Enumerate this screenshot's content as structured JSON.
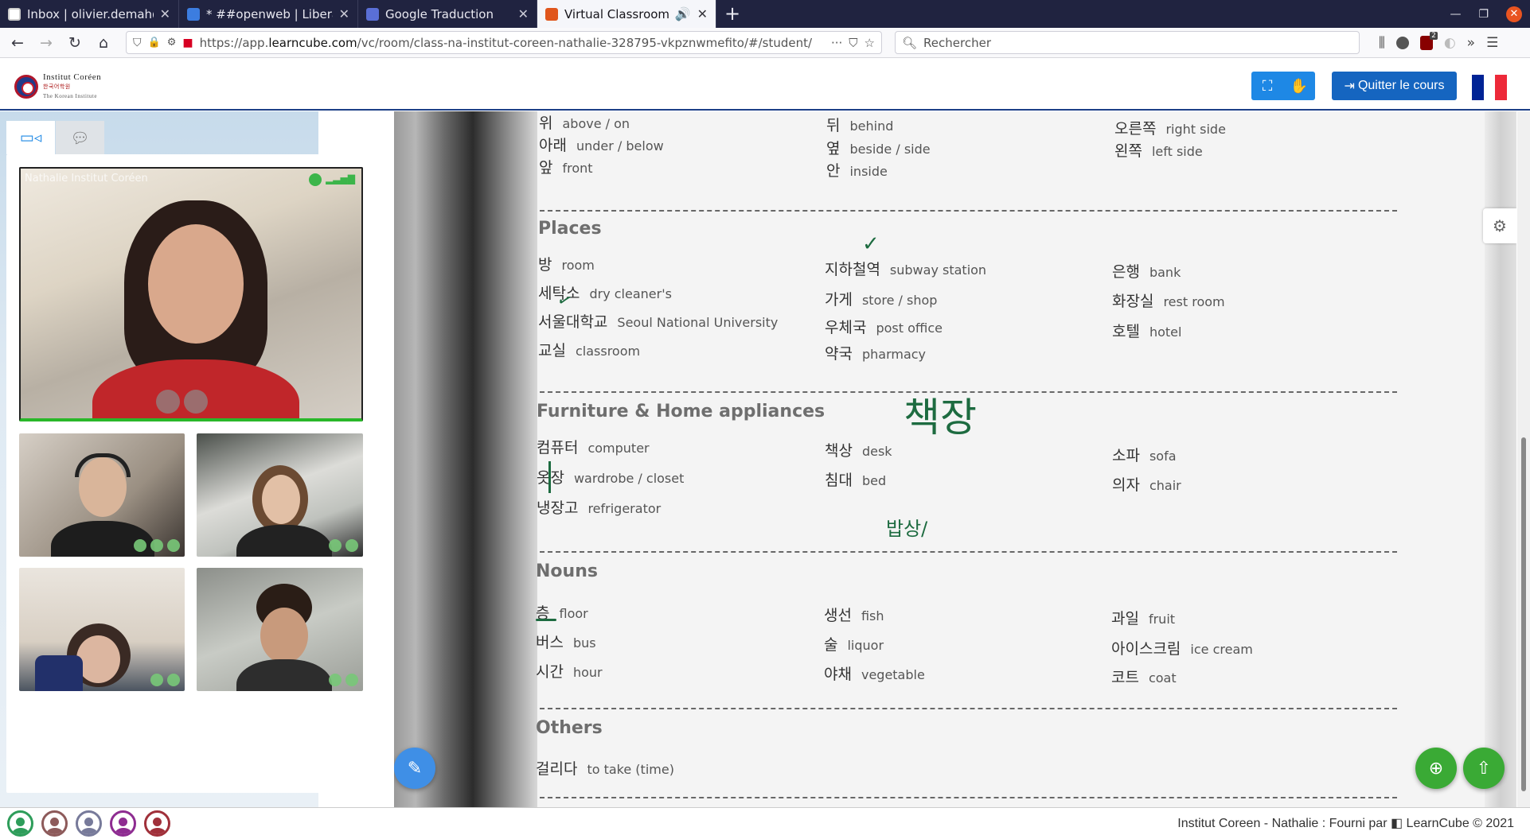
{
  "browser": {
    "tabs": [
      {
        "title": "Inbox | olivier.demah@pr",
        "icon": "envelope-icon"
      },
      {
        "title": "* ##openweb | Libera.Ch",
        "icon": "chat-icon"
      },
      {
        "title": "Google Traduction",
        "icon": "translate-icon"
      },
      {
        "title": "Virtual Classroom | Le",
        "icon": "learncube-icon",
        "active": true
      }
    ],
    "url_prefix": "https://app.",
    "url_domain": "learncube.com",
    "url_path": "/vc/room/class-na-institut-coreen-nathalie-328795-vkpznwmefito/#/student/",
    "search_placeholder": "Rechercher",
    "ublock_badge": "2"
  },
  "app": {
    "logo_line1": "Institut Coréen",
    "logo_line2": "한국어학원",
    "logo_line3": "The Korean Institute",
    "quit_label": "Quitter le cours",
    "flag_colors": [
      "#002395",
      "#ffffff",
      "#ed2939"
    ]
  },
  "video": {
    "main_label": "Nathalie Institut Coréen"
  },
  "document": {
    "top_rows": [
      {
        "ko": "위",
        "en": "above / on"
      },
      {
        "ko": "아래",
        "en": "under / below"
      },
      {
        "ko": "앞",
        "en": "front"
      },
      {
        "ko": "뒤",
        "en": "behind"
      },
      {
        "ko": "옆",
        "en": "beside / side"
      },
      {
        "ko": "안",
        "en": "inside"
      },
      {
        "ko": "오른쪽",
        "en": "right side"
      },
      {
        "ko": "왼쪽",
        "en": "left side"
      }
    ],
    "sections": {
      "places": "Places",
      "furniture": "Furniture & Home appliances",
      "nouns": "Nouns",
      "others": "Others"
    },
    "places": [
      {
        "ko": "방",
        "en": "room"
      },
      {
        "ko": "세탁소",
        "en": "dry cleaner's"
      },
      {
        "ko": "서울대학교",
        "en": "Seoul National University"
      },
      {
        "ko": "교실",
        "en": "classroom"
      },
      {
        "ko": "지하철역",
        "en": "subway station"
      },
      {
        "ko": "가게",
        "en": "store / shop"
      },
      {
        "ko": "우체국",
        "en": "post office"
      },
      {
        "ko": "약국",
        "en": "pharmacy"
      },
      {
        "ko": "은행",
        "en": "bank"
      },
      {
        "ko": "화장실",
        "en": "rest room"
      },
      {
        "ko": "호텔",
        "en": "hotel"
      }
    ],
    "furniture": [
      {
        "ko": "컴퓨터",
        "en": "computer"
      },
      {
        "ko": "옷장",
        "en": "wardrobe / closet"
      },
      {
        "ko": "냉장고",
        "en": "refrigerator"
      },
      {
        "ko": "책상",
        "en": "desk"
      },
      {
        "ko": "침대",
        "en": "bed"
      },
      {
        "ko": "소파",
        "en": "sofa"
      },
      {
        "ko": "의자",
        "en": "chair"
      }
    ],
    "nouns": [
      {
        "ko": "층",
        "en": "floor"
      },
      {
        "ko": "버스",
        "en": "bus"
      },
      {
        "ko": "시간",
        "en": "hour"
      },
      {
        "ko": "생선",
        "en": "fish"
      },
      {
        "ko": "술",
        "en": "liquor"
      },
      {
        "ko": "야채",
        "en": "vegetable"
      },
      {
        "ko": "과일",
        "en": "fruit"
      },
      {
        "ko": "아이스크림",
        "en": "ice cream"
      },
      {
        "ko": "코트",
        "en": "coat"
      }
    ],
    "others": [
      {
        "ko": "걸리다",
        "en": "to take (time)"
      }
    ],
    "handwriting": {
      "big": "책장",
      "small": "밥상/"
    }
  },
  "footer": {
    "credit": "Institut Coreen - Nathalie : Fourni par ",
    "brand": "LearnCube © 2021",
    "avatar_colors": [
      "#2e9d5a",
      "#8d5a5a",
      "#777a9a",
      "#8e2c91",
      "#a0303a"
    ]
  }
}
